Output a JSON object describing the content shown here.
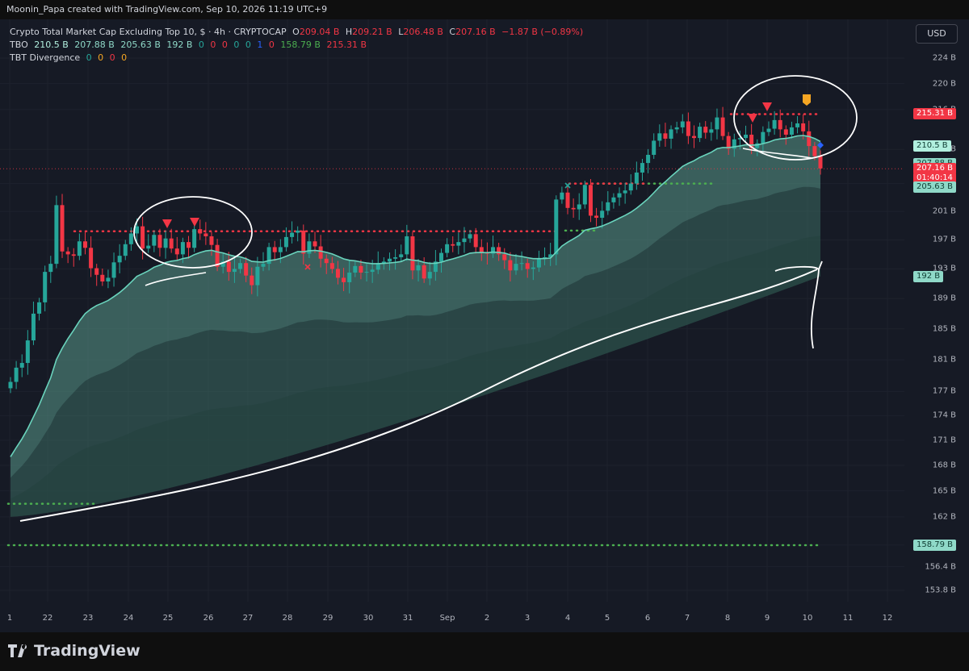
{
  "header": {
    "credit": "Moonin_Papa created with TradingView.com, Sep 10, 2026 11:19 UTC+9"
  },
  "legend": {
    "title": "Crypto Total Market Cap Excluding Top 10, $ · 4h · CRYPTOCAP",
    "o_label": "O",
    "o_val": "209.04 B",
    "h_label": "H",
    "h_val": "209.21 B",
    "l_label": "L",
    "l_val": "206.48 B",
    "c_label": "C",
    "c_val": "207.16 B",
    "change": "−1.87 B (−0.89%)",
    "tbo_label": "TBO",
    "tbo_values": [
      "210.5 B",
      "207.88 B",
      "205.63 B",
      "192 B",
      "0",
      "0",
      "0",
      "0",
      "0",
      "1",
      "0",
      "158.79 B",
      "215.31 B"
    ],
    "div_label": "TBT Divergence",
    "div_values": [
      "0",
      "0",
      "0",
      "0"
    ]
  },
  "currency_button": "USD",
  "brand": "TradingView",
  "colors": {
    "up": "#26a69a",
    "down": "#f23645",
    "teal_line": "#6ad4bd",
    "green_dots": "#4caf50",
    "red_dots": "#f23645"
  },
  "axis": {
    "scale": "log",
    "y_ticks": [
      "224 B",
      "220 B",
      "216 B",
      "210 B",
      "205 B",
      "201 B",
      "197 B",
      "193 B",
      "189 B",
      "185 B",
      "181 B",
      "177 B",
      "174 B",
      "171 B",
      "168 B",
      "165 B",
      "162 B",
      "158.8 B",
      "156.4 B",
      "153.8 B"
    ],
    "y_tick_values": [
      224,
      220,
      216,
      210,
      205,
      201,
      197,
      193,
      189,
      185,
      181,
      177,
      174,
      171,
      168,
      165,
      162,
      158.8,
      156.4,
      153.8
    ],
    "x_ticks": [
      "1",
      "22",
      "23",
      "24",
      "25",
      "26",
      "27",
      "28",
      "29",
      "30",
      "31",
      "Sep",
      "2",
      "3",
      "4",
      "5",
      "6",
      "7",
      "8",
      "9",
      "10",
      "11",
      "12"
    ]
  },
  "price_badges": [
    {
      "text": "215.31 B",
      "value": 215.31,
      "bg": "#f23645",
      "fg": "#ffffff"
    },
    {
      "text": "210.5 B",
      "value": 210.5,
      "bg": "#b2f0df",
      "fg": "#0f3d33"
    },
    {
      "text": "207.88 B",
      "value": 207.88,
      "bg": "#8fd9c8",
      "fg": "#0f3d33"
    },
    {
      "text": "207.16 B",
      "value": 207.16,
      "bg": "#f23645",
      "fg": "#ffffff"
    },
    {
      "text": "01:40:14",
      "value": 205.8,
      "bg": "#f23645",
      "fg": "#ffffff"
    },
    {
      "text": "205.63 B",
      "value": 204.5,
      "bg": "#8fd9c8",
      "fg": "#0f3d33"
    },
    {
      "text": "192 B",
      "value": 192,
      "bg": "#8fd9c8",
      "fg": "#0f3d33"
    },
    {
      "text": "158.79 B",
      "value": 158.79,
      "bg": "#8fd9c8",
      "fg": "#0f3d33"
    }
  ],
  "chart_data": {
    "type": "candlestick",
    "title": "Crypto Total Market Cap Excluding Top 10, $ · 4h · CRYPTOCAP",
    "timeframe": "4h",
    "ylim": [
      153.8,
      224
    ],
    "last": {
      "open": 209.04,
      "high": 209.21,
      "low": 206.48,
      "close": 207.16,
      "change": -1.87,
      "change_pct": -0.89
    },
    "closes": [
      178.2,
      180.0,
      180.6,
      183.5,
      187.0,
      188.5,
      192.6,
      193.7,
      201.9,
      195.4,
      195.0,
      194.8,
      196.8,
      195.9,
      193.1,
      192.2,
      191.3,
      191.8,
      193.9,
      194.8,
      196.4,
      197.9,
      198.9,
      195.8,
      196.2,
      197.7,
      195.9,
      197.2,
      195.8,
      195.0,
      196.7,
      195.9,
      198.5,
      197.9,
      197.5,
      196.3,
      193.3,
      194.0,
      192.6,
      193.0,
      193.8,
      192.1,
      190.8,
      193.3,
      193.7,
      196.0,
      195.3,
      196.0,
      197.4,
      198.0,
      198.3,
      195.1,
      196.8,
      196.1,
      194.4,
      193.8,
      193.0,
      191.8,
      191.2,
      192.5,
      193.4,
      192.5,
      192.6,
      192.9,
      193.8,
      194.0,
      194.4,
      194.6,
      195.0,
      197.5,
      192.8,
      193.5,
      191.7,
      192.6,
      194.0,
      195.2,
      196.4,
      196.2,
      196.7,
      197.2,
      197.8,
      196.0,
      195.3,
      195.1,
      196.0,
      195.0,
      194.2,
      192.8,
      193.7,
      193.8,
      193.0,
      193.2,
      194.4,
      194.6,
      195.0,
      202.7,
      203.7,
      201.5,
      201.3,
      202.0,
      204.8,
      200.4,
      200.1,
      201.1,
      202.3,
      203.0,
      203.6,
      204.0,
      205.0,
      206.6,
      208.0,
      209.2,
      211.3,
      212.4,
      211.6,
      213.0,
      213.3,
      214.2,
      212.0,
      211.7,
      213.4,
      212.5,
      213.0,
      214.8,
      212.0,
      210.1,
      211.5,
      211.7,
      212.2,
      210.2,
      210.9,
      212.6,
      213.1,
      214.4,
      213.0,
      212.2,
      213.3,
      213.9,
      212.7,
      210.5,
      209.0,
      207.2
    ],
    "series": [
      {
        "name": "TBO fast (210.5 B)",
        "last": 210.5
      },
      {
        "name": "TBO (207.88 B)",
        "last": 207.88
      },
      {
        "name": "TBO (205.63 B)",
        "last": 205.63
      },
      {
        "name": "TBO slow (192 B)",
        "last": 192
      }
    ],
    "levels": [
      {
        "name": "resistance",
        "value": 215.31,
        "style": "red-dotted"
      },
      {
        "name": "support",
        "value": 158.79,
        "style": "green-dotted"
      },
      {
        "name": "mid resistance",
        "value": 198.0,
        "style": "red-dotted"
      }
    ],
    "x_ticks": [
      "1",
      "22",
      "23",
      "24",
      "25",
      "26",
      "27",
      "28",
      "29",
      "30",
      "31",
      "Sep",
      "2",
      "3",
      "4",
      "5",
      "6",
      "7",
      "8",
      "9",
      "10",
      "11",
      "12"
    ]
  }
}
